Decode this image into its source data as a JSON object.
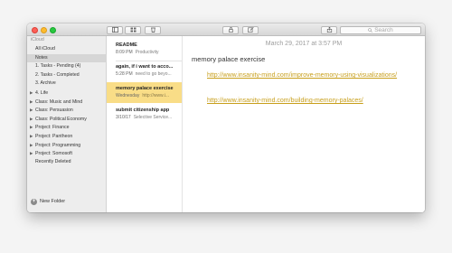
{
  "sidebar": {
    "account": "iCloud",
    "items": [
      {
        "label": "All iCloud",
        "expandable": false,
        "selected": false
      },
      {
        "label": "Notes",
        "expandable": false,
        "selected": true
      },
      {
        "label": "1. Tasks - Pending (4)",
        "expandable": false,
        "selected": false
      },
      {
        "label": "2. Tasks - Completed",
        "expandable": false,
        "selected": false
      },
      {
        "label": "3. Archive",
        "expandable": false,
        "selected": false
      },
      {
        "label": "4. Life",
        "expandable": true,
        "selected": false
      },
      {
        "label": "Class: Music and Mind",
        "expandable": true,
        "selected": false
      },
      {
        "label": "Class: Persuasion",
        "expandable": true,
        "selected": false
      },
      {
        "label": "Class: Political Economy",
        "expandable": true,
        "selected": false
      },
      {
        "label": "Project: Finance",
        "expandable": true,
        "selected": false
      },
      {
        "label": "Project: Pantheon",
        "expandable": true,
        "selected": false
      },
      {
        "label": "Project: Programming",
        "expandable": true,
        "selected": false
      },
      {
        "label": "Project: Somosoft",
        "expandable": true,
        "selected": false
      },
      {
        "label": "Recently Deleted",
        "expandable": false,
        "selected": false
      }
    ],
    "new_folder_label": "New Folder"
  },
  "toolbar": {
    "search_placeholder": "Search",
    "icons": [
      "sidebar-toggle-icon",
      "gallery-icon",
      "trash-icon",
      "lock-icon",
      "compose-icon",
      "share-icon",
      "search-icon"
    ]
  },
  "notes": [
    {
      "title": "README",
      "time": "8:09 PM",
      "snippet": "Productivity",
      "selected": false
    },
    {
      "title": "again, if i want to acco...",
      "time": "5:28 PM",
      "snippet": "need to go beyo...",
      "selected": false
    },
    {
      "title": "memory palace exercise",
      "time": "Wednesday",
      "snippet": "http://www.i...",
      "selected": true
    },
    {
      "title": "submit citizenship app",
      "time": "3/10/17",
      "snippet": "Selective Service...",
      "selected": false
    }
  ],
  "editor": {
    "date": "March 29, 2017 at 3:57 PM",
    "title": "memory palace exercise",
    "links": [
      "http://www.insanity-mind.com/improve-memory-using-visualizations/",
      "http://www.insanity-mind.com/building-memory-palaces/"
    ]
  },
  "colors": {
    "selection_yellow": "#f9dd87",
    "link_gold": "#c89f1b",
    "sidebar_bg": "#ededed"
  }
}
